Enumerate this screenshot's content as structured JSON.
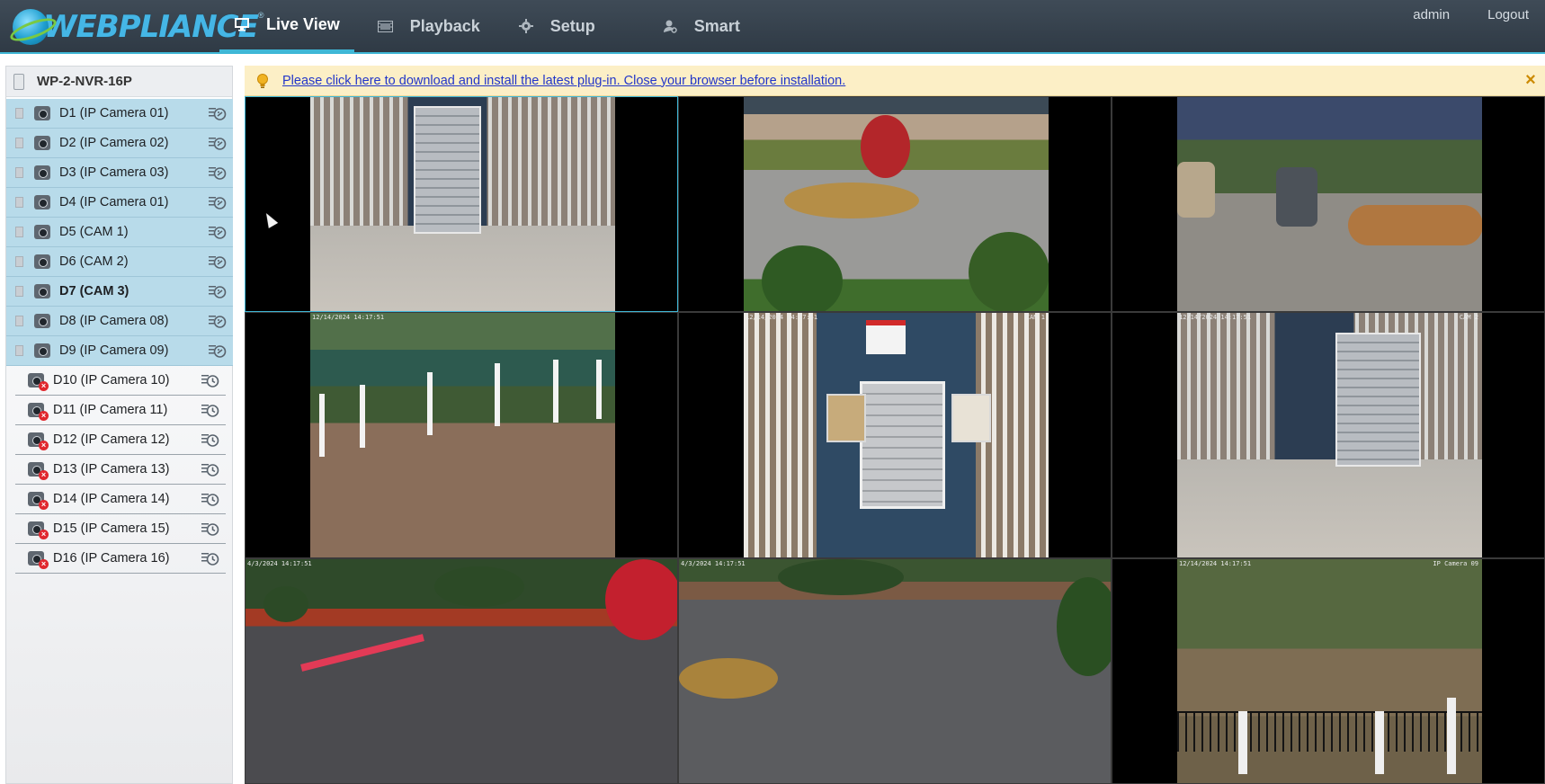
{
  "brand": {
    "name": "WEBPLIANCE",
    "trademark": "®"
  },
  "nav": {
    "items": [
      {
        "label": "Live View",
        "icon": "monitor-icon",
        "active": true
      },
      {
        "label": "Playback",
        "icon": "film-icon",
        "active": false
      },
      {
        "label": "Setup",
        "icon": "gear-icon",
        "active": false
      },
      {
        "label": "Smart",
        "icon": "person-icon",
        "active": false
      }
    ]
  },
  "user": {
    "name": "admin",
    "logout_label": "Logout"
  },
  "sidebar": {
    "device_label": "WP-2-NVR-16P",
    "cameras": [
      {
        "label": "D1 (IP Camera 01)",
        "online": true
      },
      {
        "label": "D2 (IP Camera 02)",
        "online": true
      },
      {
        "label": "D3 (IP Camera 03)",
        "online": true
      },
      {
        "label": "D4 (IP Camera 01)",
        "online": true
      },
      {
        "label": "D5 (CAM 1)",
        "online": true
      },
      {
        "label": "D6 (CAM 2)",
        "online": true
      },
      {
        "label": "D7 (CAM 3)",
        "online": true,
        "bold": true
      },
      {
        "label": "D8 (IP Camera 08)",
        "online": true
      },
      {
        "label": "D9 (IP Camera 09)",
        "online": true
      },
      {
        "label": "D10 (IP Camera 10)",
        "online": false
      },
      {
        "label": "D11 (IP Camera 11)",
        "online": false
      },
      {
        "label": "D12 (IP Camera 12)",
        "online": false
      },
      {
        "label": "D13 (IP Camera 13)",
        "online": false
      },
      {
        "label": "D14 (IP Camera 14)",
        "online": false
      },
      {
        "label": "D15 (IP Camera 15)",
        "online": false
      },
      {
        "label": "D16 (IP Camera 16)",
        "online": false
      }
    ]
  },
  "banner": {
    "message": "Please click here to download and install the latest plug-in. Close your browser before installation.",
    "close_glyph": "×"
  },
  "grid": {
    "tiles": [
      {
        "scene": "porch",
        "timestamp": "",
        "camera_name": ""
      },
      {
        "scene": "court",
        "timestamp": "",
        "camera_name": ""
      },
      {
        "scene": "parking",
        "timestamp": "",
        "camera_name": ""
      },
      {
        "scene": "fence",
        "timestamp": "12/14/2024 14:17:51",
        "camera_name": ""
      },
      {
        "scene": "mailbox",
        "timestamp": "12/14/2024 14:17:51",
        "camera_name": "CAM 1"
      },
      {
        "scene": "porch2",
        "timestamp": "12/14/2024 14:17:51",
        "camera_name": "CAM 2"
      },
      {
        "scene": "road",
        "timestamp": "4/3/2024 14:17:51",
        "camera_name": ""
      },
      {
        "scene": "road2",
        "timestamp": "4/3/2024 14:17:51",
        "camera_name": ""
      },
      {
        "scene": "yard",
        "timestamp": "12/14/2024 14:17:51",
        "camera_name": "IP Camera 09"
      }
    ]
  },
  "colors": {
    "accent": "#3fb7d6",
    "topbar": "#36424e",
    "selected_row": "#b8dbea",
    "banner_bg": "#fcefc6",
    "link": "#2236c9",
    "error": "#e0282e"
  }
}
